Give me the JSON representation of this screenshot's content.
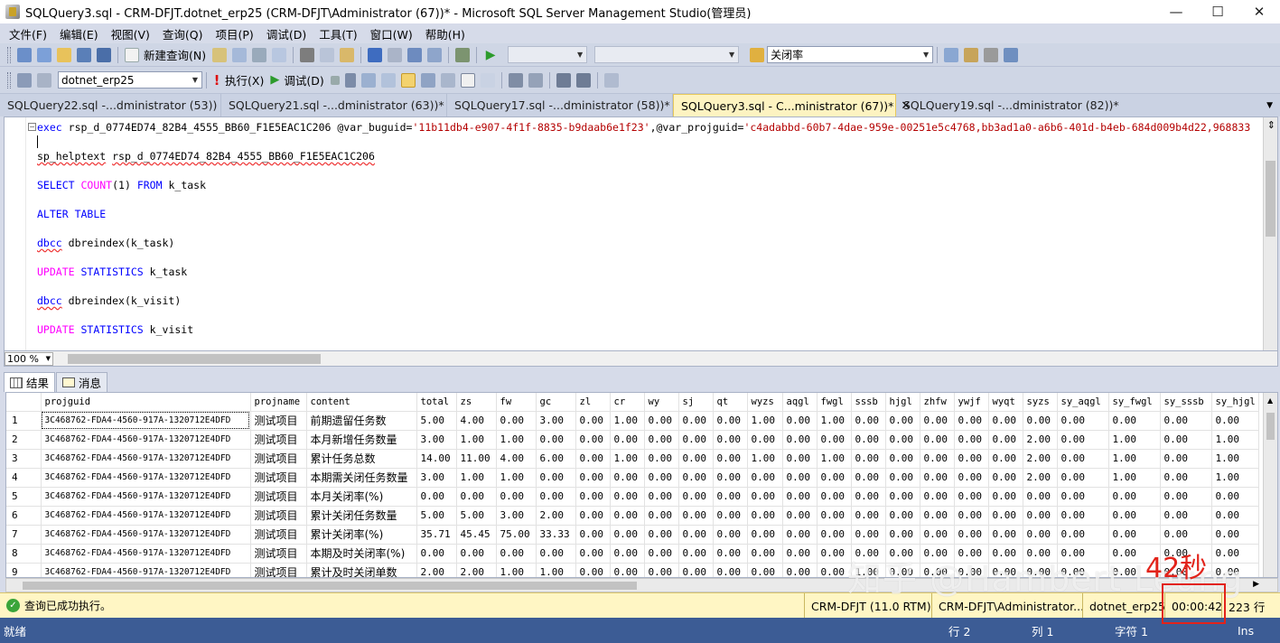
{
  "window": {
    "title": "SQLQuery3.sql - CRM-DFJT.dotnet_erp25 (CRM-DFJT\\Administrator (67))* - Microsoft SQL Server Management Studio(管理员)",
    "minimize": "—",
    "maximize": "☐",
    "close": "✕"
  },
  "menu": [
    "文件(F)",
    "编辑(E)",
    "视图(V)",
    "查询(Q)",
    "项目(P)",
    "调试(D)",
    "工具(T)",
    "窗口(W)",
    "帮助(H)"
  ],
  "toolbar1": {
    "new_query": "新建查询(N)",
    "find_combo": "关闭率"
  },
  "toolbar2": {
    "database": "dotnet_erp25",
    "execute": "执行(X)",
    "debug": "调试(D)"
  },
  "tabs": [
    {
      "label": "SQLQuery22.sql -...dministrator (53))",
      "active": false
    },
    {
      "label": "SQLQuery21.sql -...dministrator (63))*",
      "active": false
    },
    {
      "label": "SQLQuery17.sql -...dministrator (58))*",
      "active": false
    },
    {
      "label": "SQLQuery3.sql - C...ministrator (67))*",
      "active": true
    },
    {
      "label": "SQLQuery19.sql -...dministrator (82))*",
      "active": false
    }
  ],
  "editor": {
    "line1": {
      "kw": "exec",
      "proc": "rsp_d_0774ED74_82B4_4555_BB60_F1E5EAC1C206",
      "p1": "@var_buguid=",
      "v1": "'11b11db4-e907-4f1f-8835-b9daab6e1f23'",
      "p2": ",@var_projguid=",
      "v2": "'c4adabbd-60b7-4dae-959e-00251e5c4768,bb3ad1a0-a6b6-401d-b4eb-684d009b4d22,968833"
    },
    "line2": {
      "cmd": "sp_helptext",
      "arg": "rsp_d_0774ED74_82B4_4555_BB60_F1E5EAC1C206"
    },
    "line3": {
      "select": "SELECT",
      "count": "COUNT",
      "rest": "(1)",
      "from": "FROM",
      "tbl": "k_task"
    },
    "line4": {
      "alter": "ALTER",
      "table": "TABLE"
    },
    "line5": {
      "dbcc": "dbcc",
      "fn": "dbreindex",
      "arg": "(k_task)"
    },
    "line6": {
      "update": "UPDATE",
      "stats": "STATISTICS",
      "tbl": "k_task"
    },
    "line7": {
      "dbcc": "dbcc",
      "fn": "dbreindex",
      "arg": "(k_visit)"
    },
    "line8": {
      "update": "UPDATE",
      "stats": "STATISTICS",
      "tbl": "k_visit"
    },
    "zoom": "100 %"
  },
  "results_tabs": {
    "results": "结果",
    "messages": "消息"
  },
  "grid": {
    "columns": [
      "projguid",
      "projname",
      "content",
      "total",
      "zs",
      "fw",
      "gc",
      "zl",
      "cr",
      "wy",
      "sj",
      "qt",
      "wyzs",
      "aqgl",
      "fwgl",
      "sssb",
      "hjgl",
      "zhfw",
      "ywjf",
      "wyqt",
      "syzs",
      "sy_aqgl",
      "sy_fwgl",
      "sy_sssb",
      "sy_hjgl"
    ],
    "rows": [
      [
        "1",
        "3C468762-FDA4-4560-917A-1320712E4DFD",
        "测试项目",
        "前期遗留任务数",
        "5.00",
        "4.00",
        "0.00",
        "3.00",
        "0.00",
        "1.00",
        "0.00",
        "0.00",
        "0.00",
        "1.00",
        "0.00",
        "1.00",
        "0.00",
        "0.00",
        "0.00",
        "0.00",
        "0.00",
        "0.00",
        "0.00",
        "0.00",
        "0.00",
        "0.00"
      ],
      [
        "2",
        "3C468762-FDA4-4560-917A-1320712E4DFD",
        "测试项目",
        "本月新增任务数量",
        "3.00",
        "1.00",
        "1.00",
        "0.00",
        "0.00",
        "0.00",
        "0.00",
        "0.00",
        "0.00",
        "0.00",
        "0.00",
        "0.00",
        "0.00",
        "0.00",
        "0.00",
        "0.00",
        "0.00",
        "2.00",
        "0.00",
        "1.00",
        "0.00",
        "1.00"
      ],
      [
        "3",
        "3C468762-FDA4-4560-917A-1320712E4DFD",
        "测试项目",
        "累计任务总数",
        "14.00",
        "11.00",
        "4.00",
        "6.00",
        "0.00",
        "1.00",
        "0.00",
        "0.00",
        "0.00",
        "1.00",
        "0.00",
        "1.00",
        "0.00",
        "0.00",
        "0.00",
        "0.00",
        "0.00",
        "2.00",
        "0.00",
        "1.00",
        "0.00",
        "1.00"
      ],
      [
        "4",
        "3C468762-FDA4-4560-917A-1320712E4DFD",
        "测试项目",
        "本期需关闭任务数量",
        "3.00",
        "1.00",
        "1.00",
        "0.00",
        "0.00",
        "0.00",
        "0.00",
        "0.00",
        "0.00",
        "0.00",
        "0.00",
        "0.00",
        "0.00",
        "0.00",
        "0.00",
        "0.00",
        "0.00",
        "2.00",
        "0.00",
        "1.00",
        "0.00",
        "1.00"
      ],
      [
        "5",
        "3C468762-FDA4-4560-917A-1320712E4DFD",
        "测试项目",
        "本月关闭率(%)",
        "0.00",
        "0.00",
        "0.00",
        "0.00",
        "0.00",
        "0.00",
        "0.00",
        "0.00",
        "0.00",
        "0.00",
        "0.00",
        "0.00",
        "0.00",
        "0.00",
        "0.00",
        "0.00",
        "0.00",
        "0.00",
        "0.00",
        "0.00",
        "0.00",
        "0.00"
      ],
      [
        "6",
        "3C468762-FDA4-4560-917A-1320712E4DFD",
        "测试项目",
        "累计关闭任务数量",
        "5.00",
        "5.00",
        "3.00",
        "2.00",
        "0.00",
        "0.00",
        "0.00",
        "0.00",
        "0.00",
        "0.00",
        "0.00",
        "0.00",
        "0.00",
        "0.00",
        "0.00",
        "0.00",
        "0.00",
        "0.00",
        "0.00",
        "0.00",
        "0.00",
        "0.00"
      ],
      [
        "7",
        "3C468762-FDA4-4560-917A-1320712E4DFD",
        "测试项目",
        "累计关闭率(%)",
        "35.71",
        "45.45",
        "75.00",
        "33.33",
        "0.00",
        "0.00",
        "0.00",
        "0.00",
        "0.00",
        "0.00",
        "0.00",
        "0.00",
        "0.00",
        "0.00",
        "0.00",
        "0.00",
        "0.00",
        "0.00",
        "0.00",
        "0.00",
        "0.00",
        "0.00"
      ],
      [
        "8",
        "3C468762-FDA4-4560-917A-1320712E4DFD",
        "测试项目",
        "本期及时关闭率(%)",
        "0.00",
        "0.00",
        "0.00",
        "0.00",
        "0.00",
        "0.00",
        "0.00",
        "0.00",
        "0.00",
        "0.00",
        "0.00",
        "0.00",
        "0.00",
        "0.00",
        "0.00",
        "0.00",
        "0.00",
        "0.00",
        "0.00",
        "0.00",
        "0.00",
        "0.00"
      ],
      [
        "9",
        "3C468762-FDA4-4560-917A-1320712E4DFD",
        "测试项目",
        "累计及时关闭单数",
        "2.00",
        "2.00",
        "1.00",
        "1.00",
        "0.00",
        "0.00",
        "0.00",
        "0.00",
        "0.00",
        "0.00",
        "0.00",
        "0.00",
        "1.00",
        "0.00",
        "0.00",
        "0.00",
        "0.00",
        "0.00",
        "0.00",
        "0.00",
        "0.00",
        "0.00"
      ]
    ]
  },
  "query_status": {
    "message": "查询已成功执行。",
    "server": "CRM-DFJT (11.0 RTM)",
    "user": "CRM-DFJT\\Administrator...",
    "database": "dotnet_erp25",
    "elapsed": "00:00:42",
    "rows": "223 行"
  },
  "app_status": {
    "ready": "就绪",
    "line": "行 2",
    "col": "列 1",
    "char": "字符 1",
    "mode": "Ins"
  },
  "annotation": {
    "text": "42秒"
  },
  "watermark": {
    "text": "知乎 @Hambert Leung"
  }
}
